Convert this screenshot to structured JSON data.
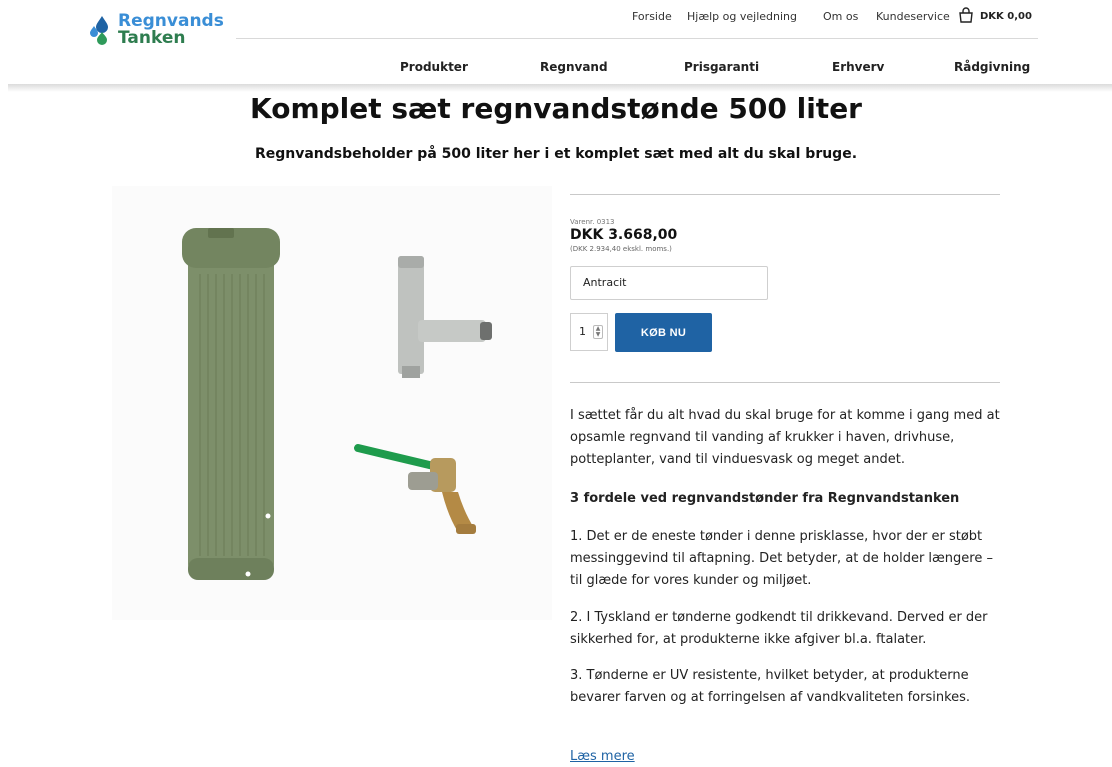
{
  "logo": {
    "line1": "Regnvands",
    "line2": "Tanken"
  },
  "top_links": [
    "Forside",
    "Hjælp og vejledning",
    "Om os",
    "Kundeservice"
  ],
  "cart": {
    "total": "DKK 0,00",
    "icon": "shopping-bag-icon"
  },
  "nav": [
    "Produkter",
    "Regnvand",
    "Prisgaranti",
    "Erhverv",
    "Rådgivning"
  ],
  "product": {
    "title": "Komplet sæt regnvandstønde 500 liter",
    "subtitle": "Regnvandsbeholder på 500 liter her i et komplet sæt med alt du skal bruge.",
    "varenr": "Varenr. 0313",
    "price": "DKK 3.668,00",
    "price_ex_vat": "(DKK 2.934,40 ekskl. moms.)",
    "variant": "Antracit",
    "quantity": "1",
    "buy_label": "KØB NU"
  },
  "description": {
    "intro": "I sættet får du alt hvad du skal bruge for at komme i gang med at opsamle regnvand til vanding af krukker i haven, drivhuse, potteplanter, vand til vinduesvask og meget andet.",
    "heading": "3 fordele ved regnvandstønder fra Regnvandstanken",
    "point1": "1. Det er de eneste tønder i denne prisklasse, hvor der er støbt messinggevind til aftapning. Det betyder, at de holder længere – til glæde for vores kunder og miljøet.",
    "point2": "2. I Tyskland er tønderne godkendt til drikkevand. Derved er der sikkerhed for, at produkterne ikke afgiver bl.a. ftalater.",
    "point3": "3. Tønderne er UV resistente, hvilket betyder, at produkterne bevarer farven og at forringelsen af vandkvaliteten forsinkes.",
    "read_more": "Læs mere"
  },
  "colors": {
    "accent": "#1f63a4",
    "logo_blue": "#3a8ed6",
    "logo_green": "#2e7d4f",
    "tank": "#7d8f6a"
  }
}
